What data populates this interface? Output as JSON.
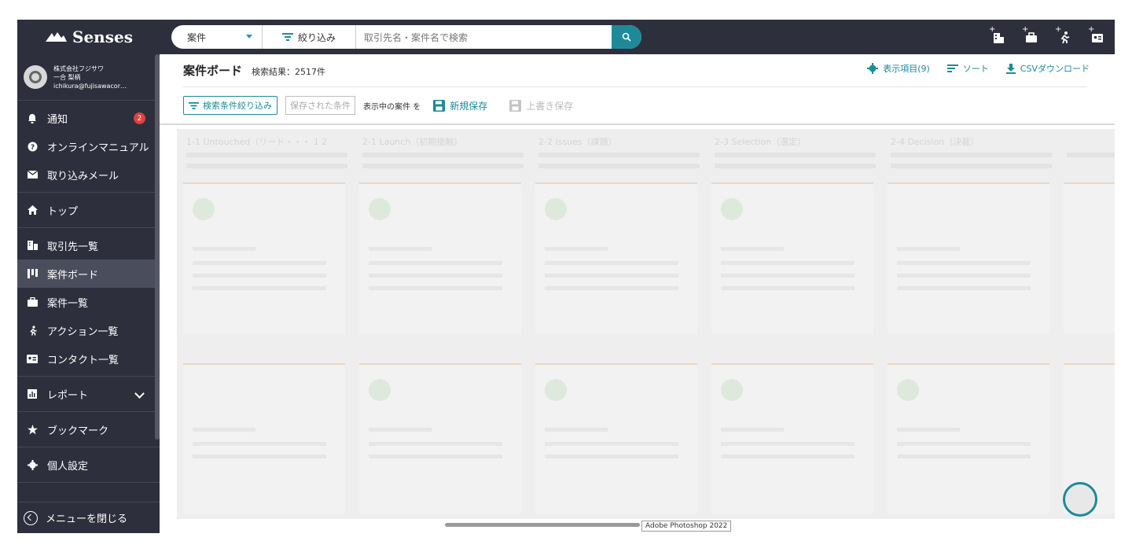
{
  "brand": {
    "name": "Senses"
  },
  "search": {
    "type_selected": "案件",
    "filter_label": "絞り込み",
    "placeholder": "取引先名・案件名で検索"
  },
  "top_icons": [
    "add-company-icon",
    "add-deal-icon",
    "add-action-icon",
    "add-contact-icon"
  ],
  "user": {
    "company": "株式会社フジサワ",
    "name": "一合 梨柄",
    "email": "ichikura@fujisawacor…"
  },
  "sidebar": {
    "notifications": {
      "label": "通知",
      "count": "2"
    },
    "manual": "オンラインマニュアル",
    "mail_import": "取り込みメール",
    "top": "トップ",
    "accounts": "取引先一覧",
    "deal_board": "案件ボード",
    "deals": "案件一覧",
    "actions": "アクション一覧",
    "contacts": "コンタクト一覧",
    "reports": "レポート",
    "bookmarks": "ブックマーク",
    "settings": "個人設定",
    "collapse": "メニューを閉じる"
  },
  "page": {
    "title": "案件ボード",
    "result": "検索結果：2517件",
    "display_items": "表示項目(9)",
    "sort": "ソート",
    "csv": "CSVダウンロード"
  },
  "toolbar": {
    "filter_button": "検索条件絞り込み",
    "saved_conditions": "保存された条件",
    "showing_text": "表示中の案件 を",
    "new_save": "新規保存",
    "overwrite_save": "上書き保存"
  },
  "board": {
    "columns": [
      {
        "title": "1-1 Untouched（リード・・・ 1 2"
      },
      {
        "title": "2-1 Launch（初期接触）"
      },
      {
        "title": "2-2 Issues（課題）"
      },
      {
        "title": "2-3 Selection（選定）"
      },
      {
        "title": "2-4 Decision（決裁）"
      }
    ]
  },
  "tooltip": "Adobe Photoshop 2022"
}
